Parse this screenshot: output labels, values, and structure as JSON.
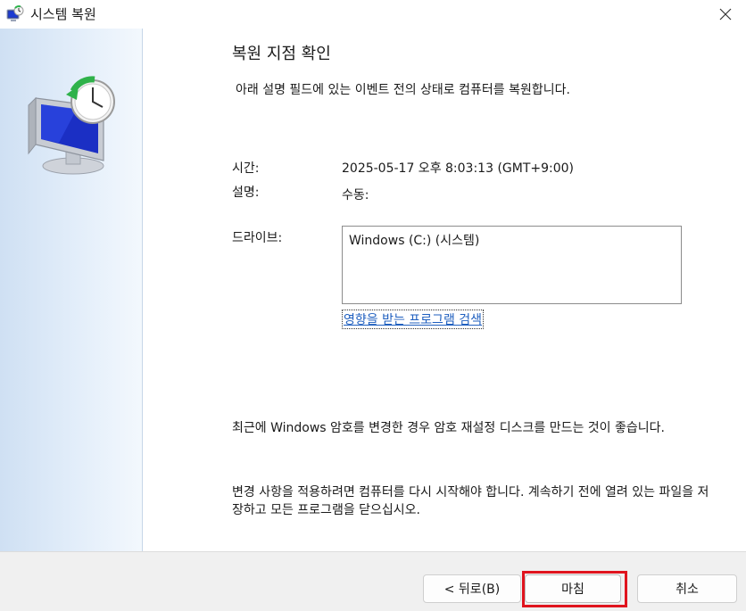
{
  "window": {
    "title": "시스템 복원",
    "app_icon": "system-restore-icon",
    "close_icon": "close-icon"
  },
  "sidebar": {
    "hero_icon": "system-restore-monitor-clock-icon"
  },
  "main": {
    "heading": "복원 지점 확인",
    "description": "아래 설명 필드에 있는 이벤트 전의 상태로 컴퓨터를 복원합니다.",
    "fields": {
      "time_label": "시간:",
      "time_value": "2025-05-17 오후 8:03:13 (GMT+9:00)",
      "desc_label": "설명:",
      "desc_value": "수동:",
      "drive_label": "드라이브:",
      "drive_list": [
        "Windows (C:) (시스템)"
      ]
    },
    "affected_programs_link": "영향을 받는 프로그램 검색",
    "note_password": "최근에 Windows 암호를 변경한 경우 암호 재설정 디스크를 만드는 것이 좋습니다.",
    "note_restart": "변경 사항을 적용하려면 컴퓨터를 다시 시작해야 합니다. 계속하기 전에 열려 있는 파일을 저장하고 모든 프로그램을 닫으십시오."
  },
  "footer": {
    "back_label": "< 뒤로(B)",
    "finish_label": "마침",
    "cancel_label": "취소"
  },
  "colors": {
    "highlight": "#e0141e",
    "link": "#1f5fbf",
    "sidebar": "#d6e5f5"
  }
}
